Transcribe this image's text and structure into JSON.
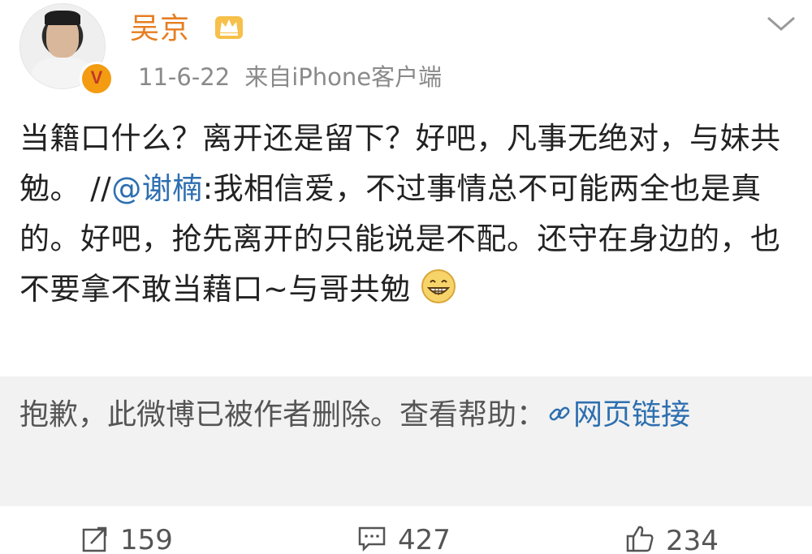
{
  "author": {
    "name": "吴京",
    "timestamp": "11-6-22",
    "source": "来自iPhone客户端",
    "avatar_icon": "user-avatar-photo",
    "verified_badge": "V",
    "crown_icon": "crown-icon"
  },
  "post": {
    "text_before_mention": "当籍口什么？离开还是留下？好吧，凡事无绝对，与妹共勉。 //",
    "mention": "@谢楠",
    "text_after_mention": ":我相信爱，不过事情总不可能两全也是真的。好吧，抢先离开的只能说是不配。还守在身边的，也不要拿不敢当藉口~与哥共勉",
    "emoji": "grin-emoji"
  },
  "repost_notice": {
    "text": "抱歉，此微博已被作者删除。查看帮助：",
    "link_label": "网页链接",
    "link_icon": "link-icon"
  },
  "actions": {
    "repost_count": "159",
    "comment_count": "427",
    "like_count": "234"
  },
  "colors": {
    "username": "#e67e22",
    "link": "#2d6fb0",
    "meta": "#8a8a8a",
    "repost_bg": "#f2f2f2"
  }
}
